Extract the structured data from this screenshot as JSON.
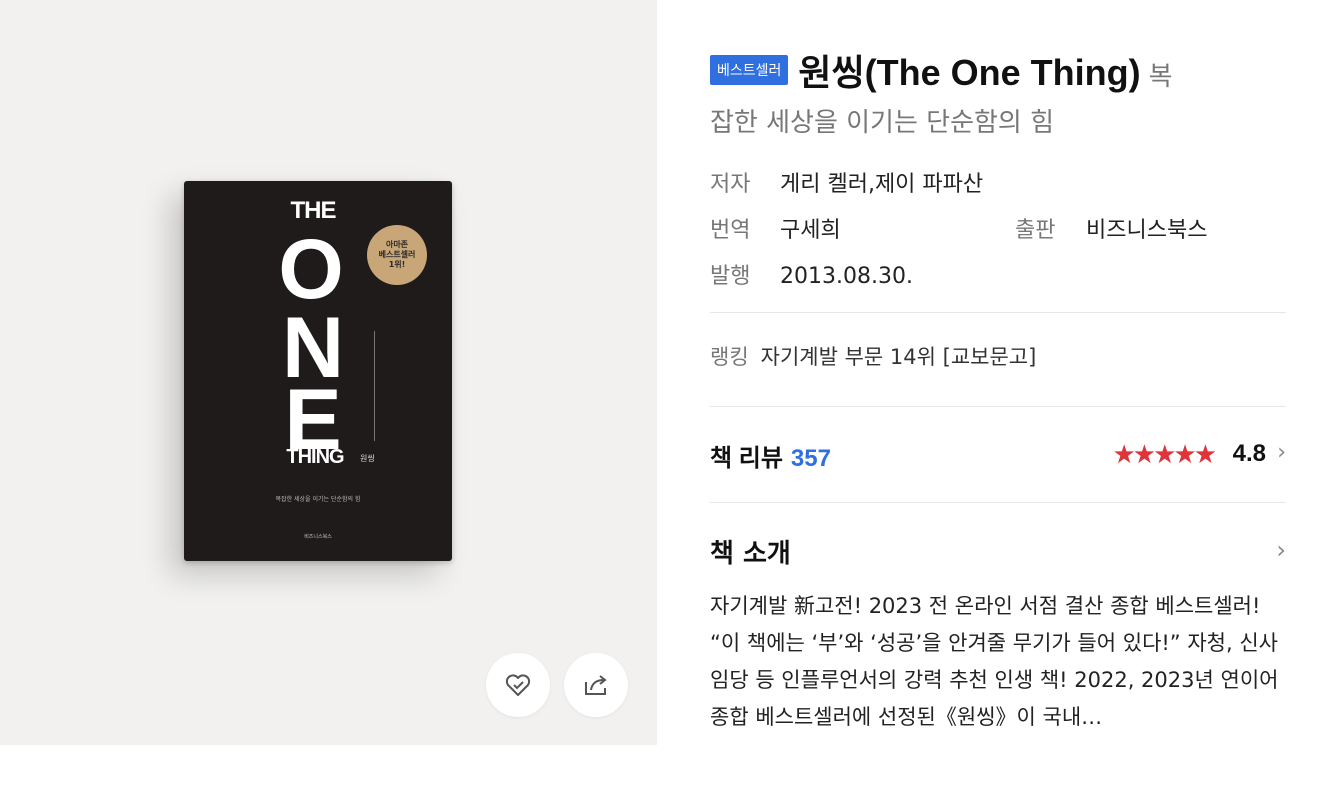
{
  "cover": {
    "book_title_top": "THE",
    "book_title_o": "O",
    "book_title_n": "N",
    "book_title_e": "E",
    "book_title_bottom": "THING",
    "book_title_kr": "원씽",
    "seal_text": "아마존\n베스트셀러\n1위!",
    "cover_subtitle": "복잡한 세상을 이기는 단순함의 힘",
    "cover_publisher": "비즈니스북스",
    "wish_icon": "heart-icon",
    "share_icon": "share-icon"
  },
  "book": {
    "badge": "베스트셀러",
    "title": "원씽(The One Thing)",
    "subtitle_part1": "복",
    "subtitle_part2": "잡한 세상을 이기는 단순함의 힘",
    "author_label": "저자",
    "author": "게리 켈러,제이 파파산",
    "translator_label": "번역",
    "translator": "구세희",
    "publisher_label": "출판",
    "publisher": "비즈니스북스",
    "pubdate_label": "발행",
    "pubdate": "2013.08.30."
  },
  "ranking": {
    "label": "랭킹",
    "text": "자기계발 부문 14위 [교보문고]"
  },
  "review": {
    "label": "책 리뷰",
    "count": "357",
    "stars": "★★★★★",
    "score": "4.8",
    "chevron": "›"
  },
  "intro": {
    "title": "책 소개",
    "chevron": "›",
    "body": "자기계발 新고전! 2023 전 온라인 서점 결산 종합 베스트셀러! “이 책에는 ‘부’와 ‘성공’을 안겨줄 무기가 들어 있다!” 자청, 신사임당 등 인플루언서의 강력 추천 인생 책! 2022, 2023년 연이어 종합 베스트셀러에 선정된《원씽》이 국내…"
  },
  "colors": {
    "accent": "#2f6fe0",
    "star": "#e0343a",
    "cover_bg": "#f2f1ef",
    "book_cover": "#1e1b1a"
  }
}
